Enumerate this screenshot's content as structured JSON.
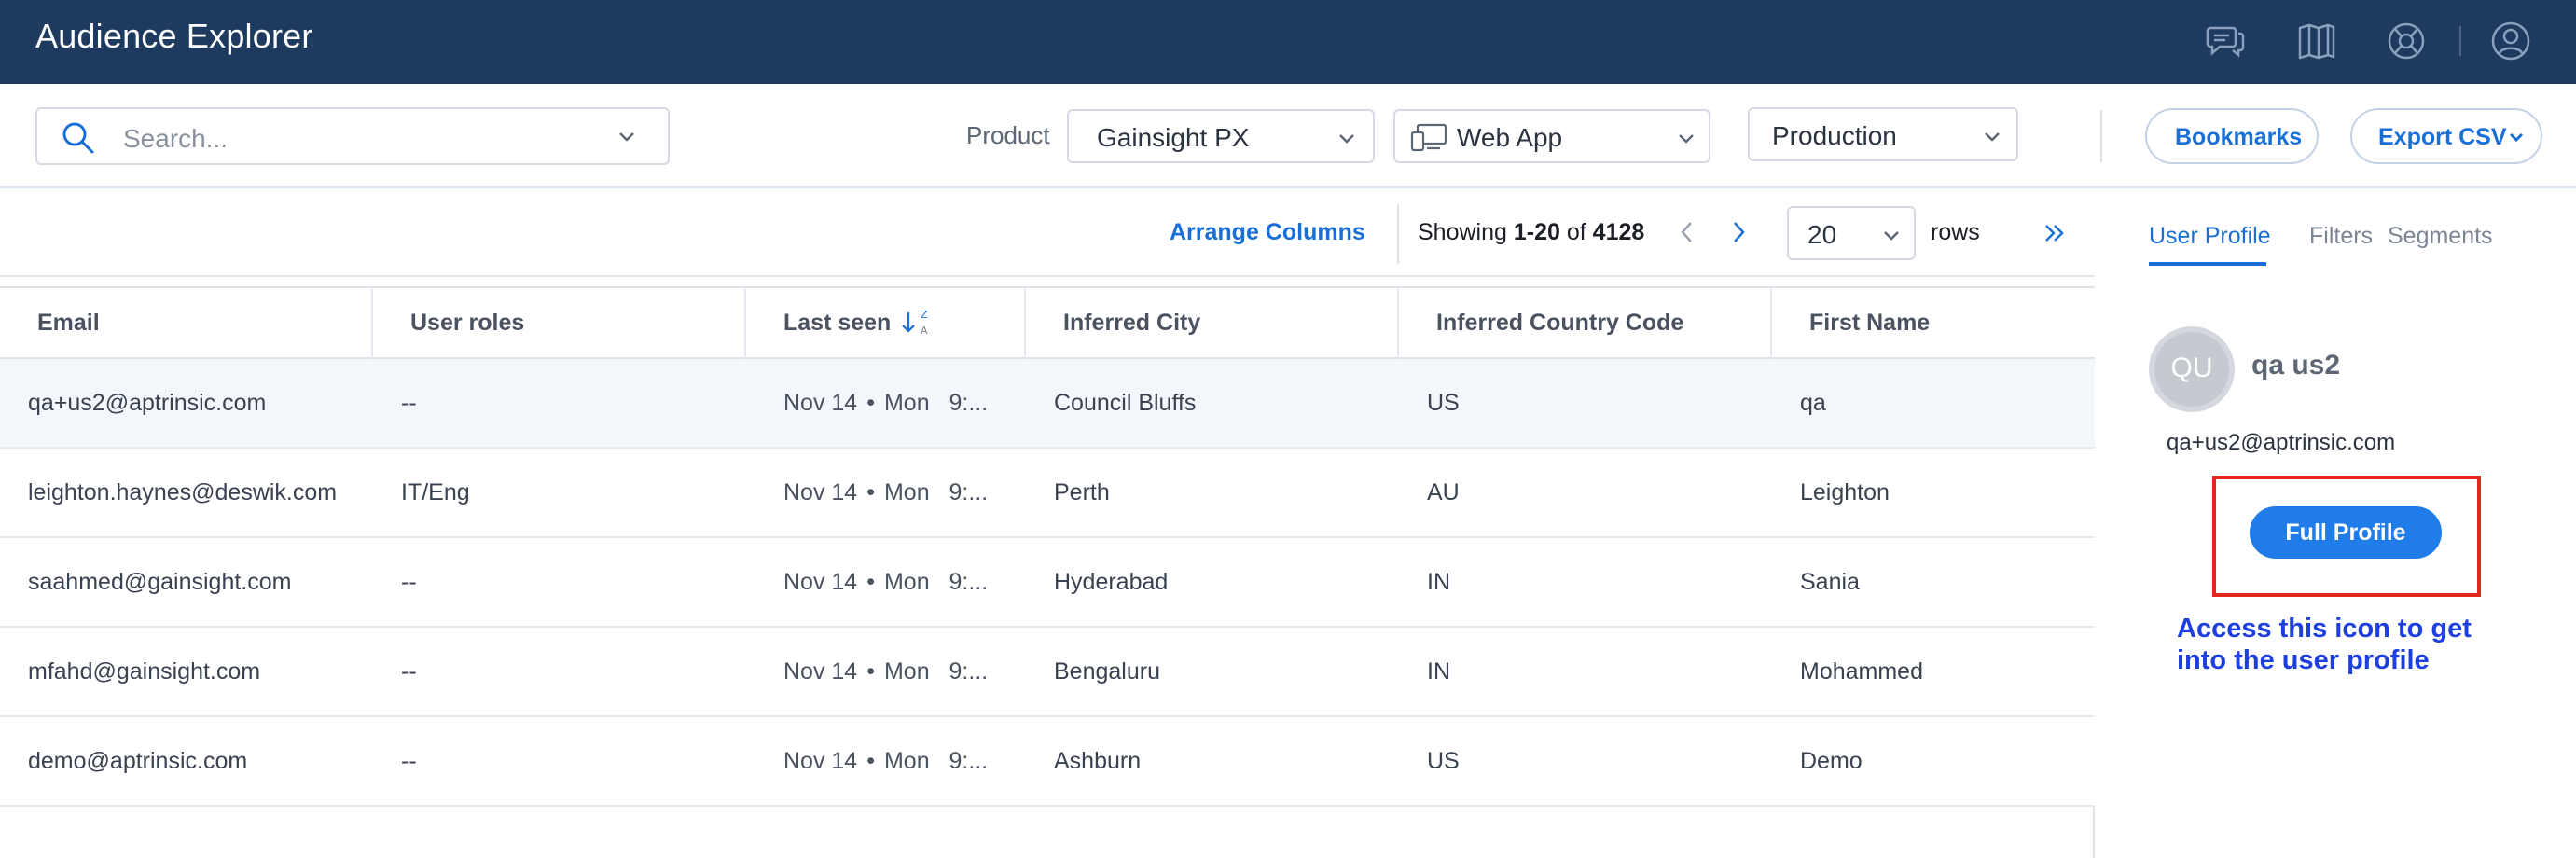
{
  "header": {
    "title": "Audience Explorer",
    "icons": [
      "chat-icon",
      "book-icon",
      "help-globe-icon",
      "user-icon"
    ]
  },
  "filters": {
    "search_placeholder": "Search...",
    "product_label": "Product",
    "product_value": "Gainsight PX",
    "app_value": "Web App",
    "environment_value": "Production",
    "bookmarks_label": "Bookmarks",
    "export_label": "Export CSV"
  },
  "toolbar": {
    "arrange_columns": "Arrange Columns",
    "showing_prefix": "Showing",
    "showing_range": "1-20",
    "showing_of": "of",
    "showing_total": "4128",
    "rows_per_page": "20",
    "rows_label": "rows"
  },
  "table": {
    "columns": [
      "Email",
      "User roles",
      "Last seen",
      "Inferred City",
      "Inferred Country Code",
      "First Name"
    ],
    "rows": [
      {
        "email": "qa+us2@aptrinsic.com",
        "roles": "--",
        "date": "Nov 14",
        "day": "Mon",
        "time": "9:...",
        "city": "Council Bluffs",
        "country": "US",
        "first": "qa"
      },
      {
        "email": "leighton.haynes@deswik.com",
        "roles": "IT/Eng",
        "date": "Nov 14",
        "day": "Mon",
        "time": "9:...",
        "city": "Perth",
        "country": "AU",
        "first": "Leighton"
      },
      {
        "email": "saahmed@gainsight.com",
        "roles": "--",
        "date": "Nov 14",
        "day": "Mon",
        "time": "9:...",
        "city": "Hyderabad",
        "country": "IN",
        "first": "Sania"
      },
      {
        "email": "mfahd@gainsight.com",
        "roles": "--",
        "date": "Nov 14",
        "day": "Mon",
        "time": "9:...",
        "city": "Bengaluru",
        "country": "IN",
        "first": "Mohammed"
      },
      {
        "email": "demo@aptrinsic.com",
        "roles": "--",
        "date": "Nov 14",
        "day": "Mon",
        "time": "9:...",
        "city": "Ashburn",
        "country": "US",
        "first": "Demo"
      }
    ]
  },
  "panel": {
    "tabs": [
      "User Profile",
      "Filters",
      "Segments"
    ],
    "avatar_initials": "QU",
    "name": "qa us2",
    "email": "qa+us2@aptrinsic.com",
    "full_profile_label": "Full Profile",
    "annotation": "Access this icon to get into the user profile"
  },
  "colors": {
    "header_bg": "#1e3a5f",
    "accent": "#1a6fd6",
    "annotation": "#1e3fe0",
    "highlight": "#e3261f"
  }
}
